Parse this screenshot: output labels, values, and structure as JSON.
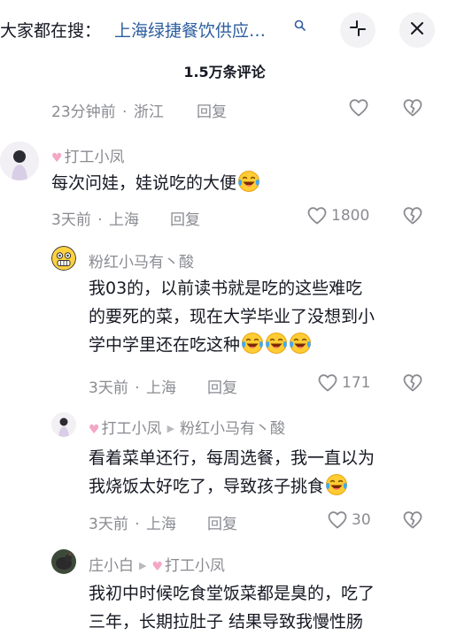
{
  "header": {
    "search_prefix": "大家都在搜：",
    "search_query": "上海绿捷餐饮供应…",
    "comment_count": "1.5万条评论"
  },
  "top_partial": {
    "meta_time": "23分钟前",
    "meta_loc": "浙江",
    "reply": "回复"
  },
  "comments": [
    {
      "user": "打工小凤",
      "text": "每次问娃，娃说吃的大便",
      "time": "3天前",
      "loc": "上海",
      "reply": "回复",
      "likes": "1800"
    },
    {
      "user": "粉红小马有丶酸",
      "lines": [
        "我03的，以前读书就是吃的这些难吃",
        "的要死的菜，现在大学毕业了没想到小",
        "学中学里还在吃这种"
      ],
      "time": "3天前",
      "loc": "上海",
      "reply": "回复",
      "likes": "171"
    },
    {
      "user": "打工小凤",
      "reply_to": "粉红小马有丶酸",
      "lines": [
        "看着菜单还行，每周选餐，我一直以为",
        "我烧饭太好吃了，导致孩子挑食"
      ],
      "time": "3天前",
      "loc": "上海",
      "reply": "回复",
      "likes": "30"
    },
    {
      "user": "庄小白",
      "reply_to": "打工小凤",
      "lines": [
        "我初中时候吃食堂饭菜都是臭的，吃了",
        "三年，长期拉肚子 结果导致我慢性肠"
      ]
    }
  ],
  "icons": {
    "search": "search-icon",
    "collapse": "collapse-icon",
    "close": "close-icon",
    "like": "heart-outline-icon",
    "dislike": "broken-heart-icon",
    "emoji": "laugh-cry-emoji"
  },
  "colors": {
    "search_query": "#2c5e9f",
    "secondary_text": "#8a8b91",
    "primary_text": "#161823"
  }
}
